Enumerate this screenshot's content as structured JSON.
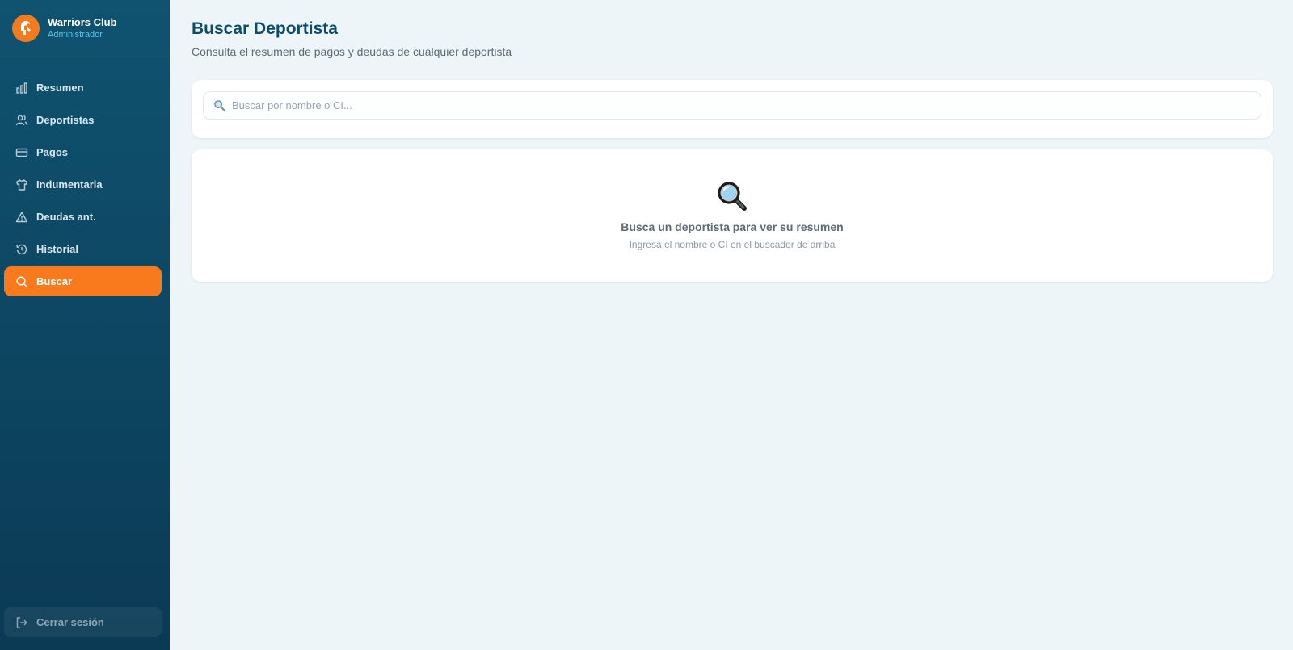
{
  "app": {
    "name": "Warriors Club",
    "role": "Administrador"
  },
  "sidebar": {
    "items": [
      {
        "label": "Resumen",
        "icon": "bar-chart-icon",
        "active": false
      },
      {
        "label": "Deportistas",
        "icon": "users-icon",
        "active": false
      },
      {
        "label": "Pagos",
        "icon": "credit-card-icon",
        "active": false
      },
      {
        "label": "Indumentaria",
        "icon": "shirt-icon",
        "active": false
      },
      {
        "label": "Deudas ant.",
        "icon": "warning-icon",
        "active": false
      },
      {
        "label": "Historial",
        "icon": "history-icon",
        "active": false
      },
      {
        "label": "Buscar",
        "icon": "search-icon",
        "active": true
      }
    ],
    "logout_label": "Cerrar sesión"
  },
  "page": {
    "title": "Buscar Deportista",
    "subtitle": "Consulta el resumen de pagos y deudas de cualquier deportista"
  },
  "search": {
    "placeholder": "Buscar por nombre o CI...",
    "value": ""
  },
  "empty_state": {
    "title": "Busca un deportista para ver su resumen",
    "subtitle": "Ingresa el nombre o CI en el buscador de arriba"
  },
  "colors": {
    "accent": "#f97a1c",
    "sidebar_top": "#0f5370",
    "sidebar_bottom": "#0b3a55",
    "title": "#0e4d6a"
  }
}
